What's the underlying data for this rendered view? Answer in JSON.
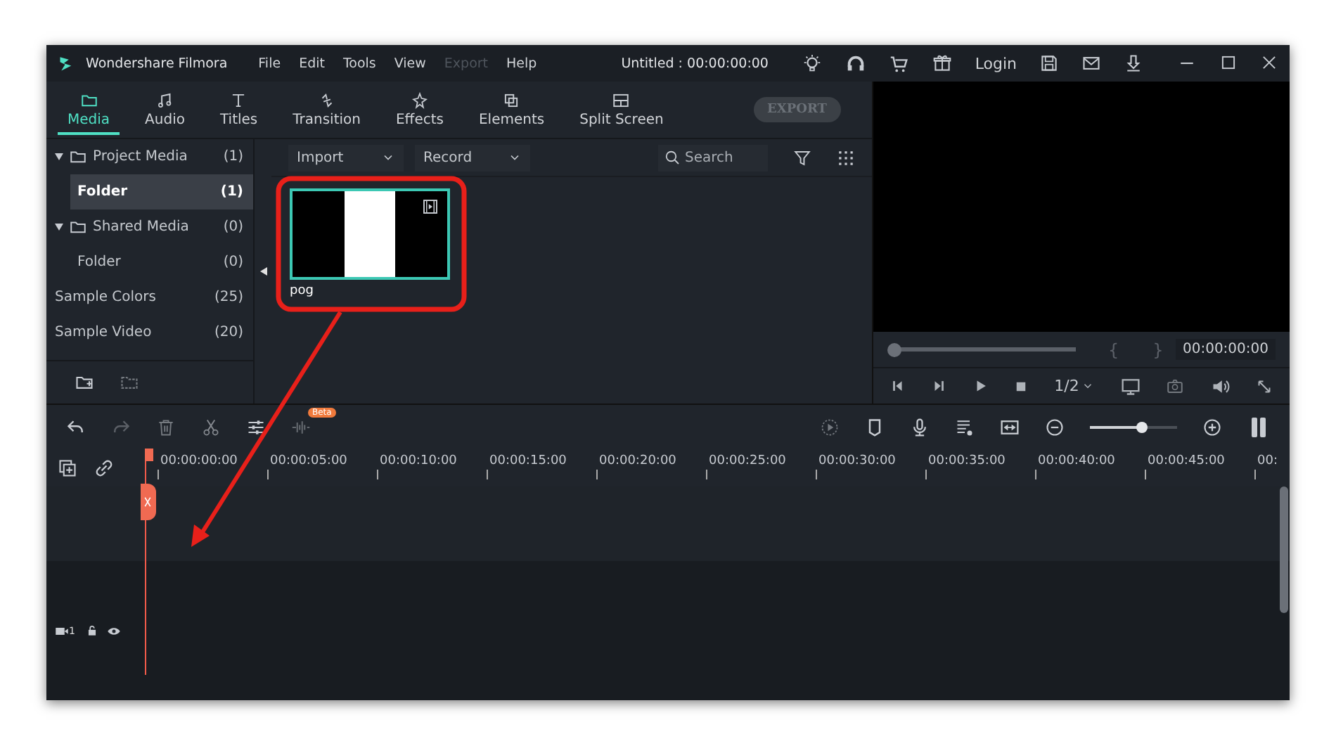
{
  "window": {
    "title": "Wondershare Filmora",
    "project_title": "Untitled : 00:00:00:00"
  },
  "menu": [
    {
      "label": "File",
      "disabled": false
    },
    {
      "label": "Edit",
      "disabled": false
    },
    {
      "label": "Tools",
      "disabled": false
    },
    {
      "label": "View",
      "disabled": false
    },
    {
      "label": "Export",
      "disabled": true
    },
    {
      "label": "Help",
      "disabled": false
    }
  ],
  "login": "Login",
  "tabs": [
    {
      "label": "Media",
      "selected": true
    },
    {
      "label": "Audio",
      "selected": false
    },
    {
      "label": "Titles",
      "selected": false
    },
    {
      "label": "Transition",
      "selected": false
    },
    {
      "label": "Effects",
      "selected": false
    },
    {
      "label": "Elements",
      "selected": false
    },
    {
      "label": "Split Screen",
      "selected": false
    }
  ],
  "export_button": {
    "label": "EXPORT",
    "disabled": true
  },
  "sidebar": {
    "items": [
      {
        "label": "Project Media",
        "count": "(1)",
        "selected": false,
        "expanded": true,
        "children": [
          {
            "label": "Folder",
            "count": "(1)",
            "selected": true
          }
        ]
      },
      {
        "label": "Shared Media",
        "count": "(0)",
        "selected": false,
        "expanded": true,
        "children": [
          {
            "label": "Folder",
            "count": "(0)",
            "selected": false
          }
        ]
      },
      {
        "label": "Sample Colors",
        "count": "(25)",
        "selected": false
      },
      {
        "label": "Sample Video",
        "count": "(20)",
        "selected": false
      }
    ]
  },
  "media_toolbar": {
    "import": "Import",
    "record": "Record",
    "search": {
      "placeholder": "Search"
    }
  },
  "media_items": [
    {
      "name": "pog",
      "selected": true
    }
  ],
  "preview": {
    "level": 0,
    "mark_in": "{",
    "mark_out": "}",
    "timecode": "00:00:00:00",
    "quality": "1/2"
  },
  "timeline": {
    "beta_badge": "Beta",
    "zoom": {
      "level": 0.6
    },
    "ruler": [
      "00:00:00:00",
      "00:00:05:00",
      "00:00:10:00",
      "00:00:15:00",
      "00:00:20:00",
      "00:00:25:00",
      "00:00:30:00",
      "00:00:35:00",
      "00:00:40:00",
      "00:00:45:00",
      "00:"
    ],
    "tracks": [
      {
        "kind": "empty"
      },
      {
        "kind": "video",
        "number": "1"
      }
    ]
  }
}
